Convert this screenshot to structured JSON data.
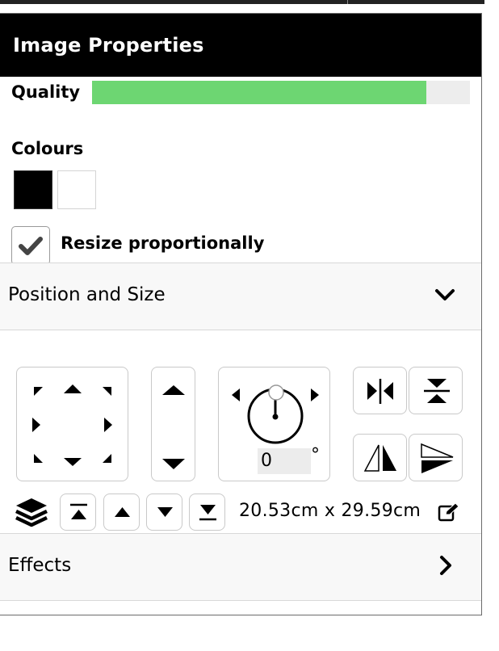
{
  "header": {
    "title": "Image Properties"
  },
  "quality": {
    "label": "Quality",
    "level": 0.885,
    "fill_color": "#6dd672"
  },
  "colours": {
    "label": "Colours",
    "swatches": [
      {
        "name": "black",
        "color": "#000000"
      },
      {
        "name": "white",
        "color": "#ffffff"
      }
    ]
  },
  "resize": {
    "label": "Resize proportionally",
    "checked": true
  },
  "position_size": {
    "title": "Position and Size",
    "expanded": true,
    "chevron_icon": "chevron-down-icon",
    "rotation": {
      "value": "0",
      "unit": "°"
    },
    "size": {
      "text": "20.53cm x 29.59cm"
    }
  },
  "effects": {
    "title": "Effects",
    "expanded": false,
    "chevron_icon": "chevron-right-icon"
  },
  "icons": [
    "move-up-left-icon",
    "move-up-icon",
    "move-up-right-icon",
    "move-left-icon",
    "move-right-icon",
    "move-down-left-icon",
    "move-down-icon",
    "move-down-right-icon",
    "scale-up-icon",
    "scale-down-icon",
    "rotation-dial-icon",
    "flip-horizontal-icon",
    "flip-vertical-icon",
    "mirror-horizontal-icon",
    "mirror-vertical-icon",
    "layers-icon",
    "bring-to-front-icon",
    "bring-forward-icon",
    "send-backward-icon",
    "send-to-back-icon",
    "edit-icon",
    "checkmark-icon"
  ]
}
